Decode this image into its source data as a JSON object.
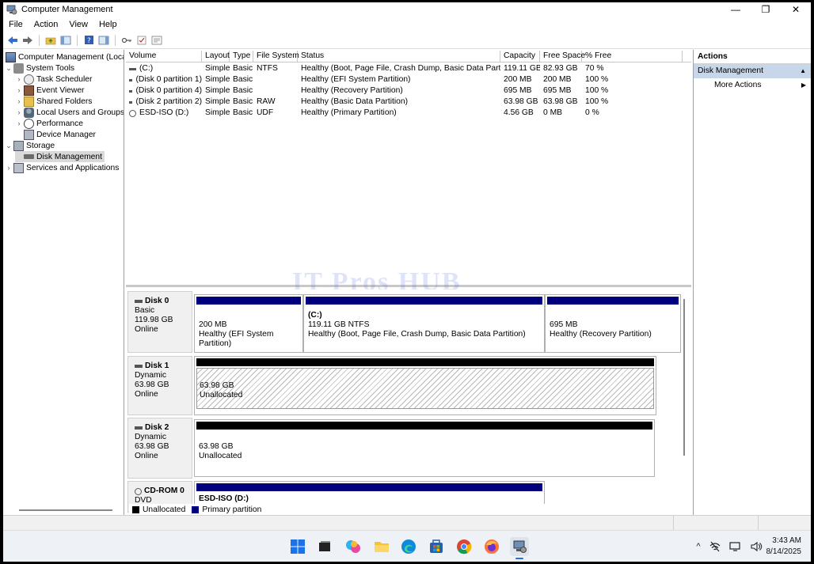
{
  "window": {
    "title": "Computer Management",
    "minimize": "—",
    "maximize": "❐",
    "close": "✕"
  },
  "menu": [
    "File",
    "Action",
    "View",
    "Help"
  ],
  "tree": [
    {
      "label": "Computer Management (Local)",
      "exp": "",
      "indent": 0
    },
    {
      "label": "System Tools",
      "exp": "⌄",
      "indent": 1
    },
    {
      "label": "Task Scheduler",
      "exp": "›",
      "indent": 2
    },
    {
      "label": "Event Viewer",
      "exp": "›",
      "indent": 2
    },
    {
      "label": "Shared Folders",
      "exp": "›",
      "indent": 2
    },
    {
      "label": "Local Users and Groups",
      "exp": "›",
      "indent": 2
    },
    {
      "label": "Performance",
      "exp": "›",
      "indent": 2
    },
    {
      "label": "Device Manager",
      "exp": "",
      "indent": 2
    },
    {
      "label": "Storage",
      "exp": "⌄",
      "indent": 1
    },
    {
      "label": "Disk Management",
      "exp": "",
      "indent": 2,
      "selected": true
    },
    {
      "label": "Services and Applications",
      "exp": "›",
      "indent": 1
    }
  ],
  "volumes": {
    "headers": [
      "Volume",
      "Layout",
      "Type",
      "File System",
      "Status",
      "Capacity",
      "Free Space",
      "% Free"
    ],
    "rows": [
      [
        "(C:)",
        "Simple",
        "Basic",
        "NTFS",
        "Healthy (Boot, Page File, Crash Dump, Basic Data Partition)",
        "119.11 GB",
        "82.93 GB",
        "70 %"
      ],
      [
        "(Disk 0 partition 1)",
        "Simple",
        "Basic",
        "",
        "Healthy (EFI System Partition)",
        "200 MB",
        "200 MB",
        "100 %"
      ],
      [
        "(Disk 0 partition 4)",
        "Simple",
        "Basic",
        "",
        "Healthy (Recovery Partition)",
        "695 MB",
        "695 MB",
        "100 %"
      ],
      [
        "(Disk 2 partition 2)",
        "Simple",
        "Basic",
        "RAW",
        "Healthy (Basic Data Partition)",
        "63.98 GB",
        "63.98 GB",
        "100 %"
      ],
      [
        "ESD-ISO (D:)",
        "Simple",
        "Basic",
        "UDF",
        "Healthy (Primary Partition)",
        "4.56 GB",
        "0 MB",
        "0 %"
      ]
    ]
  },
  "watermark": "IT Pros HUB",
  "disks": {
    "disk0": {
      "name": "Disk 0",
      "type": "Basic",
      "size": "119.98 GB",
      "state": "Online",
      "p1": {
        "size": "200 MB",
        "status": "Healthy (EFI System Partition)"
      },
      "p2": {
        "name": "(C:)",
        "size": "119.11 GB NTFS",
        "status": "Healthy (Boot, Page File, Crash Dump, Basic Data Partition)"
      },
      "p3": {
        "size": "695 MB",
        "status": "Healthy (Recovery Partition)"
      }
    },
    "disk1": {
      "name": "Disk 1",
      "type": "Dynamic",
      "size": "63.98 GB",
      "state": "Online",
      "p1": {
        "size": "63.98 GB",
        "status": "Unallocated"
      }
    },
    "disk2": {
      "name": "Disk 2",
      "type": "Dynamic",
      "size": "63.98 GB",
      "state": "Online",
      "p1": {
        "size": "63.98 GB",
        "status": "Unallocated"
      }
    },
    "cdrom0": {
      "name": "CD-ROM 0",
      "type": "DVD",
      "p1": {
        "name": "ESD-ISO (D:)"
      }
    }
  },
  "legend": {
    "unallocated": "Unallocated",
    "primary": "Primary partition"
  },
  "actions": {
    "header": "Actions",
    "section": "Disk Management",
    "section_arrow": "▲",
    "more": "More Actions",
    "more_arrow": "▶"
  },
  "clock": {
    "time": "3:43 AM",
    "date": "8/14/2025"
  },
  "tray": {
    "chevron": "^"
  },
  "colors": {
    "primary_partition": "#00007f",
    "unallocated": "#000000",
    "selection": "#d9d9d9",
    "actions_section": "#c7d6e8"
  }
}
